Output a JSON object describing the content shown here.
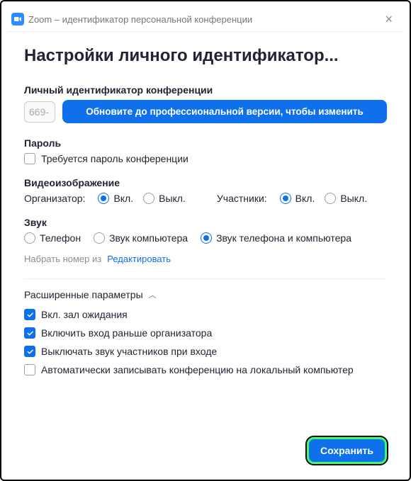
{
  "titlebar": {
    "title": "Zoom – идентификатор персональной конференции"
  },
  "page": {
    "heading": "Настройки личного идентификатор..."
  },
  "pmi": {
    "label": "Личный идентификатор конференции",
    "value": "669-",
    "upgrade_label": "Обновите до профессиональной версии, чтобы изменить"
  },
  "password": {
    "label": "Пароль",
    "require_label": "Требуется пароль конференции",
    "require_checked": false
  },
  "video": {
    "label": "Видеоизображение",
    "host_label": "Организатор:",
    "participants_label": "Участники:",
    "on_label": "Вкл.",
    "off_label": "Выкл.",
    "host_value": "on",
    "participants_value": "on"
  },
  "audio": {
    "label": "Звук",
    "options": {
      "telephone": "Телефон",
      "computer": "Звук компьютера",
      "both": "Звук телефона и компьютера"
    },
    "value": "both",
    "dial_from_label": "Набрать номер из",
    "edit_label": "Редактировать"
  },
  "advanced": {
    "label": "Расширенные параметры",
    "items": [
      {
        "label": "Вкл. зал ожидания",
        "checked": true
      },
      {
        "label": "Включить вход раньше организатора",
        "checked": true
      },
      {
        "label": "Выключать звук участников при входе",
        "checked": true
      },
      {
        "label": "Автоматически записывать конференцию на локальный компьютер",
        "checked": false
      }
    ]
  },
  "footer": {
    "save_label": "Сохранить"
  }
}
